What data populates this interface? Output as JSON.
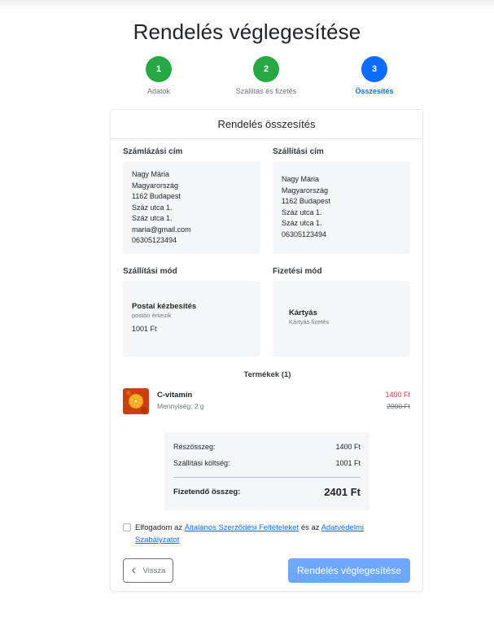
{
  "page": {
    "title": "Rendelés véglegesítése"
  },
  "steps": [
    {
      "number": "1",
      "label": "Adatok",
      "state": "done"
    },
    {
      "number": "2",
      "label": "Szállítás és fizetés",
      "state": "done"
    },
    {
      "number": "3",
      "label": "Összesítés",
      "state": "active"
    }
  ],
  "card": {
    "header": "Rendelés összesítés"
  },
  "billing": {
    "title": "Számlázási cím",
    "lines": [
      "Nagy Mária",
      "Magyarország",
      "1162 Budapest",
      "Száz utca 1.",
      "Száz utca 1.",
      "maria@gmail.com",
      "06305123494"
    ]
  },
  "shipping_address": {
    "title": "Szállítási cím",
    "lines": [
      "Nagy Mária",
      "Magyarország",
      "1162 Budapest",
      "Száz utca 1.",
      "Száz utca 1.",
      "06305123494"
    ]
  },
  "shipping_method": {
    "title": "Szállítási mód",
    "name": "Postai kézbesítés",
    "desc": "postán érkezik",
    "price": "1001 Ft"
  },
  "payment_method": {
    "title": "Fizetési mód",
    "name": "Kártyás",
    "desc": "Kártyás fizetés"
  },
  "products": {
    "title": "Termékek (1)",
    "items": [
      {
        "name": "C-vitamin",
        "qty": "Mennyiség: 2 g",
        "price": "1400 Ft",
        "old_price": "2000 Ft"
      }
    ]
  },
  "summary": {
    "subtotal_label": "Részösszeg:",
    "subtotal": "1400 Ft",
    "shipping_label": "Szállítási költség:",
    "shipping": "1001 Ft",
    "total_label": "Fizetendő összeg:",
    "total": "2401 Ft"
  },
  "terms": {
    "prefix": "Elfogadom az",
    "link1": "Általános Szerződési Feltételeket",
    "middle": "és az",
    "link2": "Adatvédelmi Szabályzatot",
    "checked": false
  },
  "buttons": {
    "back": "Vissza",
    "submit": "Rendelés véglegesítése"
  },
  "colors": {
    "success": "#28a745",
    "primary": "#0d6efd",
    "primary_disabled": "#6ea8fe",
    "danger": "#dc3545"
  },
  "icons": {
    "back": "chevron-left-icon"
  }
}
